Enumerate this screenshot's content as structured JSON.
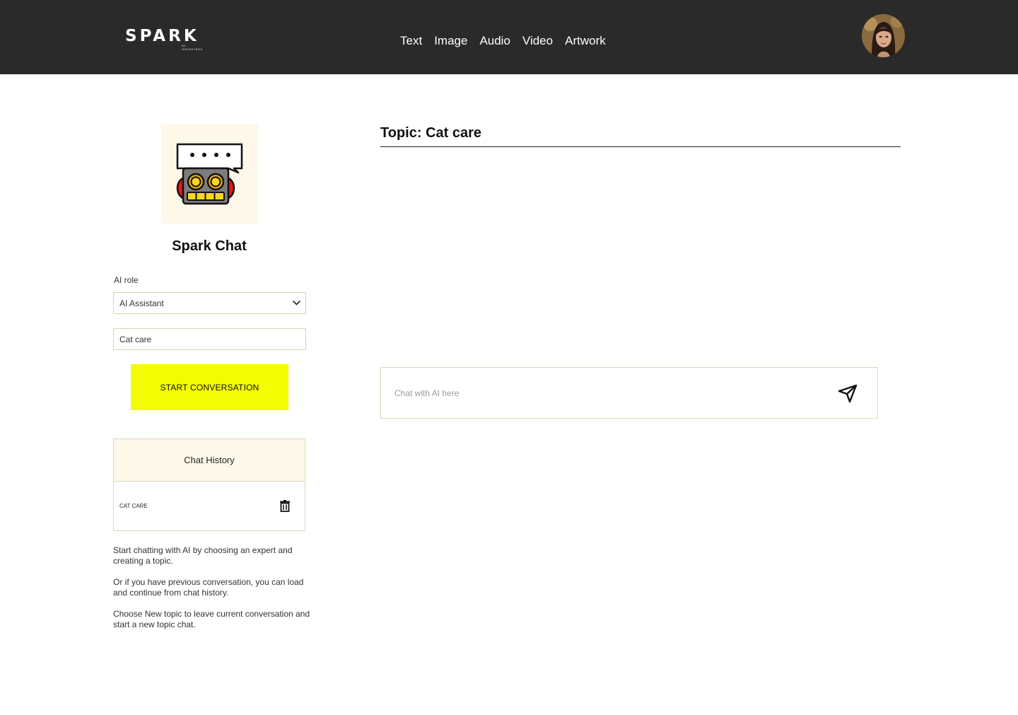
{
  "header": {
    "logo_text": "SPARK",
    "logo_subtext": "BY INSIGHTBOX",
    "nav": [
      {
        "label": "Text"
      },
      {
        "label": "Image"
      },
      {
        "label": "Audio"
      },
      {
        "label": "Video"
      },
      {
        "label": "Artwork"
      }
    ],
    "avatar_icon": "user-avatar"
  },
  "sidebar": {
    "app_icon": "robot-chat-icon",
    "app_title": "Spark Chat",
    "role_label": "AI role",
    "role_value": "AI Assistant",
    "topic_value": "Cat care",
    "start_button": "START CONVERSATION",
    "history": {
      "title": "Chat History",
      "items": [
        {
          "label": "CAT CARE",
          "icon": "trash-icon"
        }
      ]
    },
    "help": [
      "Start chatting with AI by choosing an expert and creating a topic.",
      "Or if you have previous conversation, you can load and continue from chat history.",
      "Choose New topic to leave current conversation and start a new topic chat."
    ]
  },
  "main": {
    "topic_title": "Topic: Cat care",
    "chat_placeholder": "Chat with AI here",
    "send_icon": "send-icon"
  },
  "colors": {
    "topbar": "#2a2a2a",
    "accent_yellow": "#f3fc00",
    "panel_cream": "#fdf8e9"
  }
}
